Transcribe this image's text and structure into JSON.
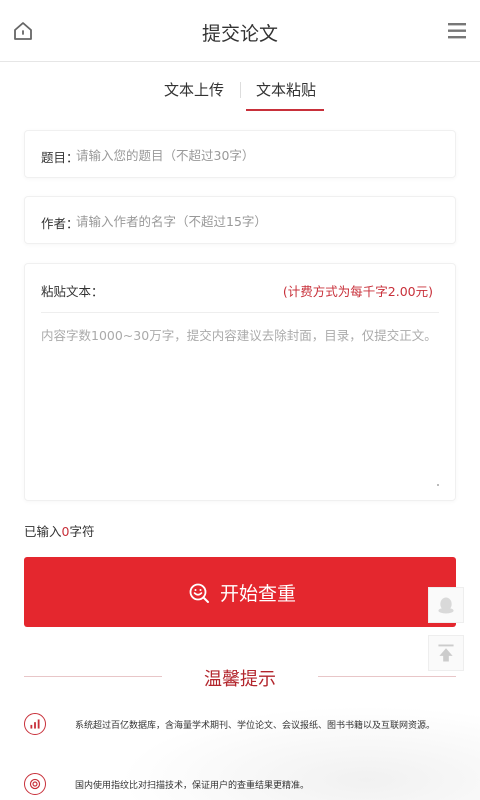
{
  "header": {
    "title": "提交论文",
    "home_icon": "home-icon",
    "menu_icon": "hamburger-menu-icon"
  },
  "tabs": [
    {
      "label": "文本上传",
      "active": false
    },
    {
      "label": "文本粘贴",
      "active": true
    }
  ],
  "form": {
    "title_field": {
      "label": "题目：",
      "placeholder": "请输入您的题目（不超过30字）",
      "value": ""
    },
    "author_field": {
      "label": "作者：",
      "placeholder": "请输入作者的名字（不超过15字）",
      "value": ""
    },
    "paste_field": {
      "label": "粘贴文本：",
      "price_note": "(计费方式为每千字2.00元)",
      "placeholder": "内容字数1000~30万字，提交内容建议去除封面，目录，仅提交正文。",
      "value": ""
    }
  },
  "counter": {
    "prefix": "已输入",
    "count": "0",
    "suffix": "字符"
  },
  "submit_button": {
    "label": "开始查重",
    "icon": "search-check-icon"
  },
  "floating": {
    "chat_icon": "qq-chat-icon",
    "top_icon": "back-to-top-icon"
  },
  "tips": {
    "title": "温馨提示",
    "items": [
      {
        "icon": "database-icon",
        "text": "系统超过百亿数据库，含海量学术期刊、学位论文、会议报纸、图书书籍以及互联网资源。"
      },
      {
        "icon": "fingerprint-icon",
        "text": "国内使用指纹比对扫描技术，保证用户的查重结果更精准。"
      }
    ]
  },
  "colors": {
    "accent": "#e4272e",
    "accent_text": "#c8303a",
    "border": "#e6e6e6"
  }
}
